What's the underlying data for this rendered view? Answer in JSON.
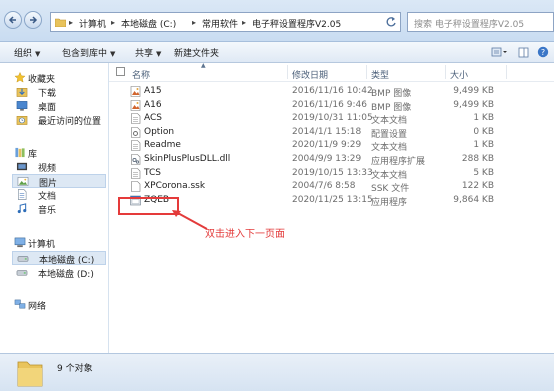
{
  "address": {
    "crumbs": [
      "计算机",
      "本地磁盘 (C:)",
      "常用软件",
      "电子秤设置程序V2.05"
    ],
    "search_placeholder": "搜索 电子秤设置程序V2.05"
  },
  "toolbar": {
    "organize": "组织",
    "include": "包含到库中",
    "share": "共享",
    "new_folder": "新建文件夹"
  },
  "nav": {
    "favorites": "收藏夹",
    "downloads": "下载",
    "desktop": "桌面",
    "recent": "最近访问的位置",
    "libraries": "库",
    "videos": "视频",
    "pictures": "图片",
    "documents": "文档",
    "music": "音乐",
    "computer": "计算机",
    "drive_c": "本地磁盘 (C:)",
    "drive_d": "本地磁盘 (D:)",
    "network": "网络"
  },
  "columns": {
    "name": "名称",
    "date": "修改日期",
    "type": "类型",
    "size": "大小"
  },
  "files": [
    {
      "name": "A15",
      "date": "2016/11/16 10:42",
      "type": "BMP 图像",
      "size": "9,499 KB",
      "icon": "bmp-image-icon"
    },
    {
      "name": "A16",
      "date": "2016/11/16 9:46",
      "type": "BMP 图像",
      "size": "9,499 KB",
      "icon": "bmp-image-icon"
    },
    {
      "name": "ACS",
      "date": "2019/10/31 11:05",
      "type": "文本文档",
      "size": "1 KB",
      "icon": "text-file-icon"
    },
    {
      "name": "Option",
      "date": "2014/1/1 15:18",
      "type": "配置设置",
      "size": "0 KB",
      "icon": "config-file-icon"
    },
    {
      "name": "Readme",
      "date": "2020/11/9 9:29",
      "type": "文本文档",
      "size": "1 KB",
      "icon": "text-file-icon"
    },
    {
      "name": "SkinPlusPlusDLL.dll",
      "date": "2004/9/9 13:29",
      "type": "应用程序扩展",
      "size": "288 KB",
      "icon": "dll-file-icon"
    },
    {
      "name": "TCS",
      "date": "2019/10/15 13:33",
      "type": "文本文档",
      "size": "5 KB",
      "icon": "text-file-icon"
    },
    {
      "name": "XPCorona.ssk",
      "date": "2004/7/6 8:58",
      "type": "SSK 文件",
      "size": "122 KB",
      "icon": "generic-file-icon"
    },
    {
      "name": "ZQEB",
      "date": "2020/11/25 13:15",
      "type": "应用程序",
      "size": "9,864 KB",
      "icon": "application-icon"
    }
  ],
  "annotation": "双击进入下一页面",
  "status": {
    "count_text": "9 个对象"
  },
  "colors": {
    "annotation": "#e33b3b",
    "header_text": "#4c607a",
    "selected_nav": "#dde8f4"
  }
}
